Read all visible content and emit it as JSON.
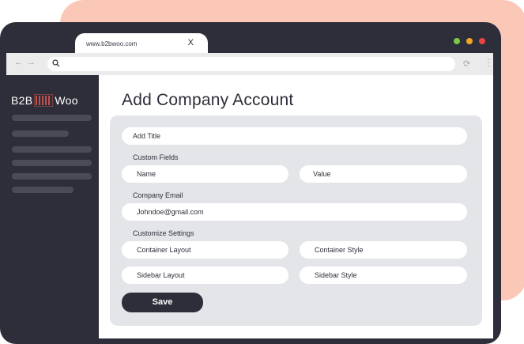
{
  "browser": {
    "tab_title": "www.b2bwoo.com",
    "tab_close": "X",
    "controls_colors": [
      "#7bc84a",
      "#f4a623",
      "#e84540"
    ]
  },
  "brand": {
    "left": "B2B",
    "right": "Woo",
    "accent_color": "#c0504a"
  },
  "page": {
    "title": "Add Company Account"
  },
  "form": {
    "add_title_placeholder": "Add Title",
    "custom_fields_label": "Custom Fields",
    "name_placeholder": "Name",
    "value_placeholder": "Value",
    "company_email_label": "Company Email",
    "company_email_value": "Johndoe@gmail.com",
    "customize_settings_label": "Customize Settings",
    "container_layout": "Container Layout",
    "container_style": "Container Style",
    "sidebar_layout": "Sidebar Layout",
    "sidebar_style": "Sidebar Style",
    "save_label": "Save"
  },
  "icons": {
    "back": "arrow-left-icon",
    "forward": "arrow-right-icon",
    "search": "search-icon",
    "reload": "reload-icon",
    "more": "more-vertical-icon"
  }
}
